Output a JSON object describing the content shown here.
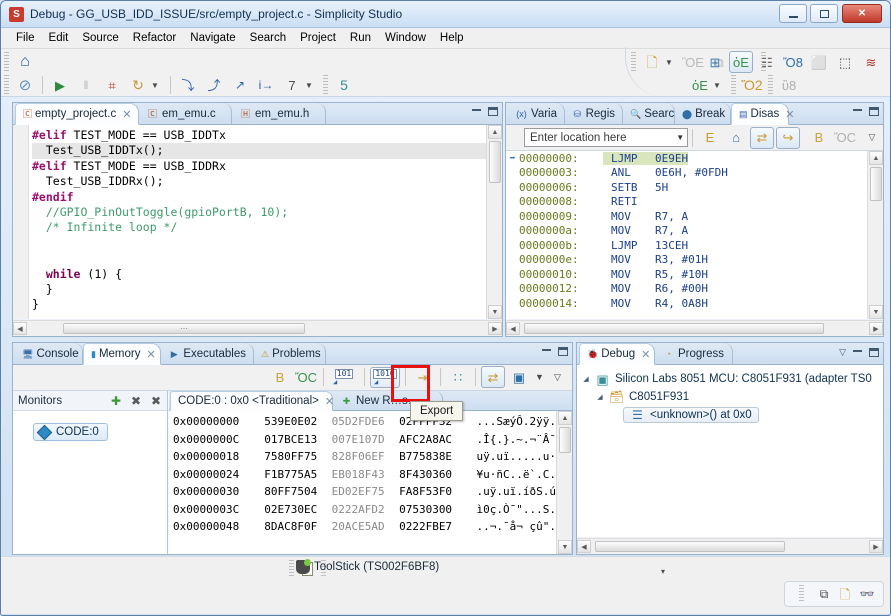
{
  "window": {
    "title": "Debug - GG_USB_IDD_ISSUE/src/empty_project.c - Simplicity Studio",
    "app_icon": "simplicity-studio-icon",
    "minimize": "–",
    "maximize": "❐",
    "close": "✕"
  },
  "menubar": {
    "items": [
      "File",
      "Edit",
      "Source",
      "Refactor",
      "Navigate",
      "Search",
      "Project",
      "Run",
      "Window",
      "Help"
    ]
  },
  "toolbar": {
    "row1": [
      {
        "name": "home-icon",
        "glyph": "⌂"
      },
      {
        "name": "new-wizard-icon",
        "glyph": "὜B"
      },
      {
        "name": "new-wizard-dropdown",
        "glyph": "▾"
      },
      {
        "name": "save-icon",
        "glyph": "ὋE"
      },
      {
        "name": "save-all-icon",
        "glyph": "⧉"
      },
      {
        "name": "print-icon",
        "glyph": "⎙"
      }
    ],
    "row2": [
      {
        "name": "skip-breakpoints-icon",
        "glyph": "⊘"
      },
      {
        "name": "resume-icon",
        "glyph": "▶"
      },
      {
        "name": "suspend-icon",
        "glyph": "‖"
      },
      {
        "name": "terminate-disconnect-icon",
        "glyph": "⌗"
      },
      {
        "name": "restart-icon",
        "glyph": "↻"
      },
      {
        "name": "restart-dropdown",
        "glyph": "▾"
      },
      {
        "name": "step-into-icon",
        "glyph": "⤵"
      },
      {
        "name": "step-over-icon",
        "glyph": "⤴"
      },
      {
        "name": "step-return-icon",
        "glyph": "↗"
      },
      {
        "name": "instruction-stepping-icon",
        "glyph": "i→"
      },
      {
        "name": "snapshot-icon",
        "glyph": "὏7"
      },
      {
        "name": "snapshot-dropdown",
        "glyph": "▾"
      },
      {
        "name": "mcu-icon",
        "glyph": "὚5"
      },
      {
        "name": "debug-icon",
        "glyph": "ὁE"
      },
      {
        "name": "debug-dropdown",
        "glyph": "▾"
      },
      {
        "name": "open-resource-icon",
        "glyph": "Ὄ2"
      },
      {
        "name": "build-icon",
        "glyph": "ὒ8"
      }
    ],
    "perspectives": [
      {
        "name": "perspective-open-icon",
        "glyph": "⊞"
      },
      {
        "name": "perspective-debug-icon",
        "glyph": "ὁE",
        "pressed": true
      },
      {
        "name": "perspective-simplicity-icon",
        "glyph": "☷"
      },
      {
        "name": "perspective-energy-profiler-icon",
        "glyph": "Ὄ8"
      },
      {
        "name": "perspective-console-icon",
        "glyph": "⬜"
      },
      {
        "name": "perspective-pin-tool-icon",
        "glyph": "⬚"
      },
      {
        "name": "perspective-network-analyzer-icon",
        "glyph": "≋"
      }
    ]
  },
  "editor": {
    "tabs": [
      {
        "label": "empty_project.c",
        "icon": "c-file-icon",
        "active": true,
        "closable": true
      },
      {
        "label": "em_emu.c",
        "icon": "c-file-icon",
        "active": false,
        "closable": false
      },
      {
        "label": "em_emu.h",
        "icon": "h-file-icon",
        "active": false,
        "closable": false
      }
    ],
    "code_lines": [
      {
        "highlight": false,
        "segments": [
          {
            "cls": "c-pp",
            "t": "#elif"
          },
          {
            "cls": "c-id",
            "t": " TEST_MODE == USB_IDDTx"
          }
        ]
      },
      {
        "highlight": true,
        "segments": [
          {
            "cls": "c-id",
            "t": "  Test_USB_IDDTx();"
          }
        ]
      },
      {
        "highlight": false,
        "segments": [
          {
            "cls": "c-pp",
            "t": "#elif"
          },
          {
            "cls": "c-id",
            "t": " TEST_MODE == USB_IDDRx"
          }
        ]
      },
      {
        "highlight": false,
        "segments": [
          {
            "cls": "c-id",
            "t": "  Test_USB_IDDRx();"
          }
        ]
      },
      {
        "highlight": false,
        "segments": [
          {
            "cls": "c-pp",
            "t": "#endif"
          }
        ]
      },
      {
        "highlight": false,
        "segments": [
          {
            "cls": "c-cm",
            "t": "  //GPIO_PinOutToggle(gpioPortB, 10);"
          }
        ]
      },
      {
        "highlight": false,
        "segments": [
          {
            "cls": "c-cm",
            "t": "  /* Infinite loop */"
          }
        ]
      },
      {
        "highlight": false,
        "segments": [
          {
            "cls": "c-id",
            "t": ""
          }
        ]
      },
      {
        "highlight": false,
        "segments": [
          {
            "cls": "c-id",
            "t": ""
          }
        ]
      },
      {
        "highlight": false,
        "segments": [
          {
            "cls": "c-kw",
            "t": "  while"
          },
          {
            "cls": "c-id",
            "t": " (1) {"
          }
        ]
      },
      {
        "highlight": false,
        "segments": [
          {
            "cls": "c-id",
            "t": "  }"
          }
        ]
      },
      {
        "highlight": false,
        "segments": [
          {
            "cls": "c-id",
            "t": "}"
          }
        ]
      }
    ],
    "hscroll_grip": "⋯"
  },
  "disassembly": {
    "tabs": [
      {
        "label": "Varia",
        "icon": "variables-icon",
        "active": false,
        "closable": false
      },
      {
        "label": "Regis",
        "icon": "registers-icon",
        "active": false,
        "closable": false
      },
      {
        "label": "Searc",
        "icon": "search-icon",
        "active": false,
        "closable": false
      },
      {
        "label": "Break",
        "icon": "breakpoints-icon",
        "active": false,
        "closable": false
      },
      {
        "label": "Disas",
        "icon": "disassembly-icon",
        "active": true,
        "closable": true
      }
    ],
    "location_input": {
      "value": "",
      "placeholder": "Enter location here"
    },
    "tools": [
      {
        "name": "link-to-source-icon",
        "glyph": "὜E"
      },
      {
        "name": "home-address-icon",
        "glyph": "⌂"
      },
      {
        "name": "show-addresses-icon",
        "glyph": "⇄",
        "pressed": true
      },
      {
        "name": "show-opcodes-icon",
        "glyph": "↪",
        "pressed": true
      },
      {
        "name": "new-view-icon",
        "glyph": "὜B"
      },
      {
        "name": "pin-view-icon",
        "glyph": "ὌC"
      },
      {
        "name": "view-menu-icon",
        "glyph": "▽"
      }
    ],
    "rows": [
      {
        "arrow": true,
        "addr": "00000000:",
        "mn": "LJMP",
        "op": "0E9EH",
        "selected": true
      },
      {
        "arrow": false,
        "addr": "00000003:",
        "mn": "ANL",
        "op": "0E6H, #0FDH",
        "selected": false
      },
      {
        "arrow": false,
        "addr": "00000006:",
        "mn": "SETB",
        "op": "5H",
        "selected": false
      },
      {
        "arrow": false,
        "addr": "00000008:",
        "mn": "RETI",
        "op": "",
        "selected": false
      },
      {
        "arrow": false,
        "addr": "00000009:",
        "mn": "MOV",
        "op": "R7, A",
        "selected": false
      },
      {
        "arrow": false,
        "addr": "0000000a:",
        "mn": "MOV",
        "op": "R7, A",
        "selected": false
      },
      {
        "arrow": false,
        "addr": "0000000b:",
        "mn": "LJMP",
        "op": "13CEH",
        "selected": false
      },
      {
        "arrow": false,
        "addr": "0000000e:",
        "mn": "MOV",
        "op": "R3, #01H",
        "selected": false
      },
      {
        "arrow": false,
        "addr": "00000010:",
        "mn": "MOV",
        "op": "R5, #10H",
        "selected": false
      },
      {
        "arrow": false,
        "addr": "00000012:",
        "mn": "MOV",
        "op": "R6, #00H",
        "selected": false
      },
      {
        "arrow": false,
        "addr": "00000014:",
        "mn": "MOV",
        "op": "R4, 0A8H",
        "selected": false
      }
    ]
  },
  "memory": {
    "tabs": [
      {
        "label": "Console",
        "icon": "console-icon",
        "active": false,
        "closable": false
      },
      {
        "label": "Memory",
        "icon": "memory-icon",
        "active": true,
        "closable": true
      },
      {
        "label": "Executables",
        "icon": "executables-icon",
        "active": false,
        "closable": false
      },
      {
        "label": "Problems",
        "icon": "problems-icon",
        "active": false,
        "closable": false
      }
    ],
    "tools": [
      {
        "name": "new-memory-view-icon",
        "glyph": "὜B"
      },
      {
        "name": "pin-memory-view-icon",
        "glyph": "ὌC"
      },
      {
        "name": "import-icon",
        "glyph": "101",
        "label": "101"
      },
      {
        "name": "export-icon",
        "glyph": "1010",
        "label": "1010",
        "highlighted": true,
        "tooltip": "Export"
      },
      {
        "name": "link-memory-rendering-icon",
        "glyph": "⇥"
      },
      {
        "name": "toggle-split-pane-icon",
        "glyph": "∷"
      },
      {
        "name": "toggle-memory-monitors-icon",
        "glyph": "⇄",
        "pressed": true
      },
      {
        "name": "memory-layout-icon",
        "glyph": "▣"
      },
      {
        "name": "memory-menu-dropdown",
        "glyph": "▾"
      },
      {
        "name": "view-menu-icon",
        "glyph": "▽"
      }
    ],
    "monitors": {
      "title": "Monitors",
      "actions": [
        {
          "name": "add-monitor-icon",
          "glyph": "✚"
        },
        {
          "name": "remove-monitor-icon",
          "glyph": "✖"
        },
        {
          "name": "remove-all-monitors-icon",
          "glyph": "✖"
        }
      ],
      "items": [
        {
          "label": "CODE:0",
          "icon": "memory-monitor-icon"
        }
      ]
    },
    "renderings": {
      "tabs": [
        {
          "label": "CODE:0 : 0x0 <Traditional>",
          "active": true,
          "closable": true
        },
        {
          "label": "New R…s…",
          "icon": "add-rendering-icon",
          "active": false,
          "closable": false
        }
      ],
      "rows": [
        {
          "addr": "0x00000000",
          "g": [
            "539E0E02",
            "05D2FDE6",
            "02FFFF32"
          ],
          "dim": [
            false,
            true,
            false
          ],
          "ascii": "...SæýÔ.2ÿÿ."
        },
        {
          "addr": "0x0000000C",
          "g": [
            "017BCE13",
            "007E107D",
            "AFC2A8AC"
          ],
          "dim": [
            false,
            true,
            false
          ],
          "ascii": ".Î{.}.~.¬¨Â¯"
        },
        {
          "addr": "0x00000018",
          "g": [
            "7580FF75",
            "828F06EF",
            "B775838E"
          ],
          "dim": [
            false,
            true,
            false
          ],
          "ascii": "uÿ.uï.....u·"
        },
        {
          "addr": "0x00000024",
          "g": [
            "F1B775A5",
            "EB018F43",
            "8F430360"
          ],
          "dim": [
            false,
            true,
            false
          ],
          "ascii": "¥u·ñC..ë`.C."
        },
        {
          "addr": "0x00000030",
          "g": [
            "80FF7504",
            "ED02EF75",
            "FA8F53F0"
          ],
          "dim": [
            false,
            true,
            false
          ],
          "ascii": ".uÿ.uï.íðS.ú"
        },
        {
          "addr": "0x0000003C",
          "g": [
            "02E730EC",
            "0222AFD2",
            "07530300"
          ],
          "dim": [
            false,
            true,
            false
          ],
          "ascii": "ì0ç.Ò¯\"...S."
        },
        {
          "addr": "0x00000048",
          "g": [
            "8DAC8F0F",
            "20ACE5AD",
            "0222FBE7"
          ],
          "dim": [
            false,
            true,
            false
          ],
          "ascii": "..¬.¯å¬ çû\"."
        }
      ]
    }
  },
  "debug_view": {
    "tabs": [
      {
        "label": "Debug",
        "icon": "debug-icon",
        "active": true,
        "closable": true
      },
      {
        "label": "Progress",
        "icon": "progress-icon",
        "active": false,
        "closable": false
      }
    ],
    "tree": [
      {
        "indent": 0,
        "twisty": "◢",
        "icon": "mcu-chip-icon",
        "label": "Silicon Labs 8051 MCU: C8051F931 (adapter TS0",
        "selected": false
      },
      {
        "indent": 1,
        "twisty": "◢",
        "icon": "thread-icon",
        "label": "C8051F931",
        "selected": false
      },
      {
        "indent": 2,
        "twisty": "",
        "icon": "stack-frame-icon",
        "label": "<unknown>() at 0x0",
        "selected": true
      }
    ]
  },
  "status_bar": {
    "writable_icon": "writable-indicator-icon",
    "device": "ToolStick (TS002F6BF8)",
    "device_icon": "toolstick-icon",
    "dropdown": "▾",
    "right_icons": [
      {
        "name": "tile-windows-icon",
        "glyph": "⧉"
      },
      {
        "name": "copy-to-clipboard-icon",
        "glyph": "ὌB"
      },
      {
        "name": "spell-check-icon",
        "glyph": "ὅ3"
      }
    ]
  }
}
